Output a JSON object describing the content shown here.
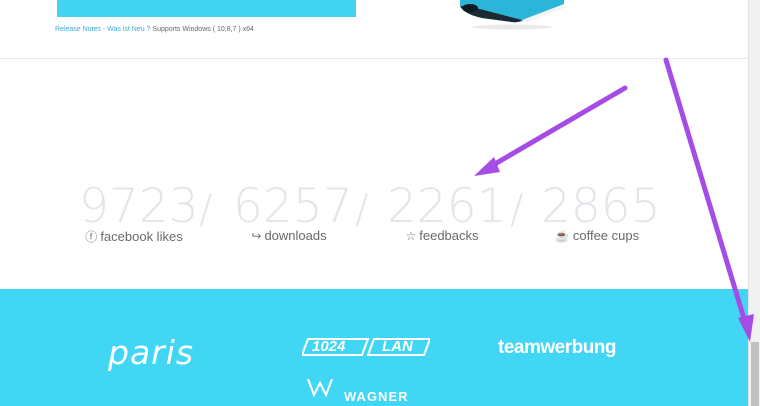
{
  "header": {
    "release_notes_link": "Release Notes - Was ist Neu ?",
    "supports_text": " Supports Windows ( 10,8,7 ) x64"
  },
  "stats": [
    {
      "value": "9723",
      "label": "facebook likes",
      "icon": "facebook-icon"
    },
    {
      "value": "6257",
      "label": "downloads",
      "icon": "share-icon"
    },
    {
      "value": "2261",
      "label": "feedbacks",
      "icon": "star-icon"
    },
    {
      "value": "2865",
      "label": "coffee cups",
      "icon": "coffee-icon"
    }
  ],
  "separator": "/",
  "sponsors": {
    "paris": "paris",
    "lan_number": "1024",
    "lan_text": "LAN",
    "team": "teamwerbung",
    "wagner": "WAGNER"
  },
  "colors": {
    "accent": "#42d6f5",
    "annotation": "#a64ce6",
    "stat_number": "#e2e6ea"
  }
}
